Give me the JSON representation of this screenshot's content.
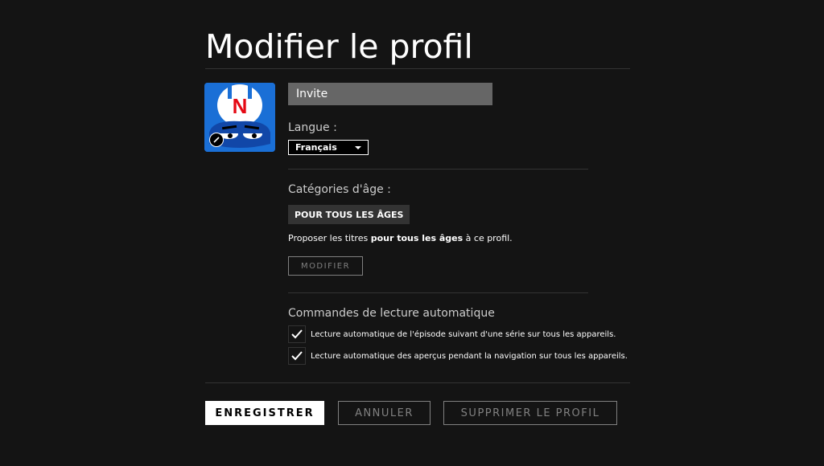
{
  "page": {
    "title": "Modifier le profil"
  },
  "profile": {
    "name_value": "Invite",
    "avatar_icon": "netflix-kids-avatar-icon",
    "edit_icon": "pencil-icon"
  },
  "language": {
    "label": "Langue :",
    "selected": "Français"
  },
  "age": {
    "label": "Catégories d'âge :",
    "badge": "POUR TOUS LES ÂGES",
    "desc_prefix": "Proposer les titres ",
    "desc_bold": "pour tous les âges",
    "desc_suffix": " à ce profil.",
    "modify_button": "MODIFIER"
  },
  "autoplay": {
    "label": "Commandes de lecture automatique",
    "options": [
      {
        "text": "Lecture automatique de l'épisode suivant d'une série sur tous les appareils.",
        "checked": true
      },
      {
        "text": "Lecture automatique des aperçus pendant la navigation sur tous les appareils.",
        "checked": true
      }
    ]
  },
  "buttons": {
    "save": "ENREGISTRER",
    "cancel": "ANNULER",
    "delete": "SUPPRIMER LE PROFIL"
  },
  "colors": {
    "background": "#141414",
    "brand_red": "#e50914",
    "avatar_blue": "#1a6fd6",
    "input_gray": "#666666"
  }
}
